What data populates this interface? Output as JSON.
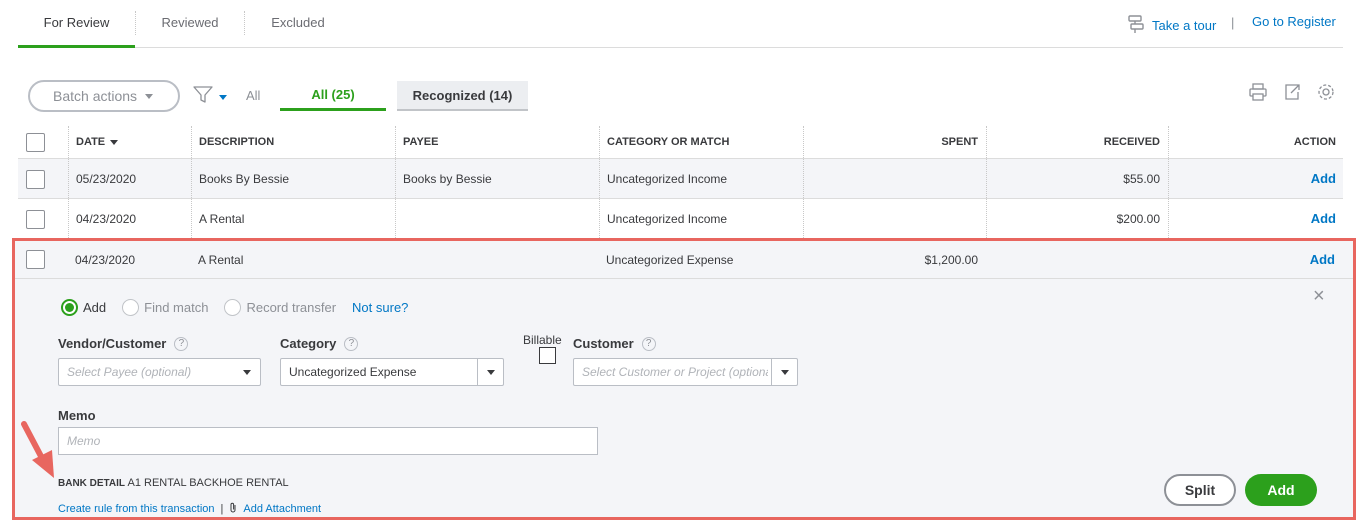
{
  "tabs": [
    {
      "label": "For Review",
      "active": true
    },
    {
      "label": "Reviewed",
      "active": false
    },
    {
      "label": "Excluded",
      "active": false
    }
  ],
  "top_links": {
    "take_tour": "Take a tour",
    "separator": "|",
    "go_to_register": "Go to Register"
  },
  "toolbar": {
    "batch_actions": "Batch actions",
    "filter_all": "All",
    "segments": [
      {
        "label": "All (25)",
        "active": true
      },
      {
        "label": "Recognized (14)",
        "active": false
      }
    ]
  },
  "table": {
    "columns": [
      "DATE",
      "DESCRIPTION",
      "PAYEE",
      "CATEGORY OR MATCH",
      "SPENT",
      "RECEIVED",
      "ACTION"
    ],
    "rows": [
      {
        "date": "05/23/2020",
        "description": "Books By Bessie",
        "payee": "Books by Bessie",
        "category": "Uncategorized Income",
        "spent": "",
        "received": "$55.00",
        "action": "Add"
      },
      {
        "date": "04/23/2020",
        "description": "A Rental",
        "payee": "",
        "category": "Uncategorized Income",
        "spent": "",
        "received": "$200.00",
        "action": "Add"
      },
      {
        "date": "04/23/2020",
        "description": "A Rental",
        "payee": "",
        "category": "Uncategorized Expense",
        "spent": "$1,200.00",
        "received": "",
        "action": "Add"
      }
    ]
  },
  "detail": {
    "radio_options": [
      "Add",
      "Find match",
      "Record transfer"
    ],
    "not_sure": "Not sure?",
    "close": "×",
    "vendor_label": "Vendor/Customer",
    "vendor_placeholder": "Select Payee (optional)",
    "category_label": "Category",
    "category_value": "Uncategorized Expense",
    "billable_label": "Billable",
    "customer_label": "Customer",
    "customer_placeholder": "Select Customer or Project (optional)",
    "memo_label": "Memo",
    "memo_placeholder": "Memo",
    "bank_detail_label": "BANK DETAIL",
    "bank_detail_value": "A1 RENTAL BACKHOE RENTAL",
    "create_rule": "Create rule from this transaction",
    "link_separator": "|",
    "add_attachment": "Add Attachment",
    "split_button": "Split",
    "add_button": "Add"
  },
  "colors": {
    "accent_green": "#2ca01c",
    "link_blue": "#0077c5",
    "highlight_red": "#e8665f"
  }
}
